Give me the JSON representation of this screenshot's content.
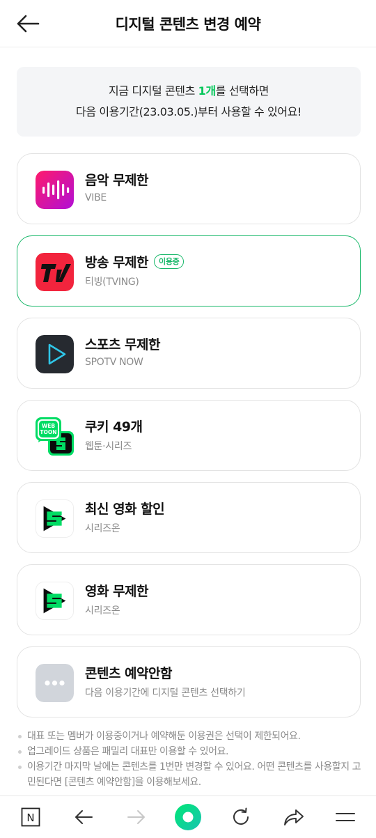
{
  "header": {
    "title": "디지털 콘텐츠 변경 예약",
    "back_icon": "arrow-left-icon"
  },
  "notice": {
    "line1_prefix": "지금 디지털 콘텐츠 ",
    "line1_highlight": "1개",
    "line1_suffix": "를 선택하면",
    "line2": "다음 이용기간(23.03.05.)부터 사용할 수 있어요!"
  },
  "options": [
    {
      "title": "음악 무제한",
      "subtitle": "VIBE",
      "icon": "vibe-icon",
      "selected": false
    },
    {
      "title": "방송 무제한",
      "subtitle": "티빙(TVING)",
      "icon": "tving-icon",
      "selected": true,
      "badge": "이용중"
    },
    {
      "title": "스포츠 무제한",
      "subtitle": "SPOTV NOW",
      "icon": "spotv-now-icon",
      "selected": false
    },
    {
      "title": "쿠키 49개",
      "subtitle": "웹툰·시리즈",
      "icon": "webtoon-series-icon",
      "selected": false
    },
    {
      "title": "최신 영화 할인",
      "subtitle": "시리즈온",
      "icon": "series-on-icon",
      "selected": false
    },
    {
      "title": "영화 무제한",
      "subtitle": "시리즈온",
      "icon": "series-on-icon",
      "selected": false
    },
    {
      "title": "콘텐츠 예약안함",
      "subtitle": "다음 이용기간에 디지털 콘텐츠 선택하기",
      "icon": "more-dots-icon",
      "selected": false
    }
  ],
  "notes": [
    "대표 또는 멤버가 이용중이거나 예약해둔 이용권은 선택이 제한되어요.",
    "업그레이드 상품은 패밀리 대표만 이용할 수 있어요.",
    "이용기간 마지막 날에는 콘텐츠를 1번만 변경할 수 있어요. 어떤 콘텐츠를 사용할지 고민된다면 [콘텐츠 예약안함]을 이용해보세요."
  ],
  "bottom_nav": {
    "items": [
      "naver-home-icon",
      "back-arrow-icon",
      "forward-arrow-icon",
      "green-circle-icon",
      "refresh-icon",
      "share-icon",
      "menu-icon"
    ],
    "home_letter": "N"
  },
  "colors": {
    "accent_green": "#03c75a",
    "selected_border": "#19b86a",
    "notice_bg": "#f4f5f7"
  }
}
